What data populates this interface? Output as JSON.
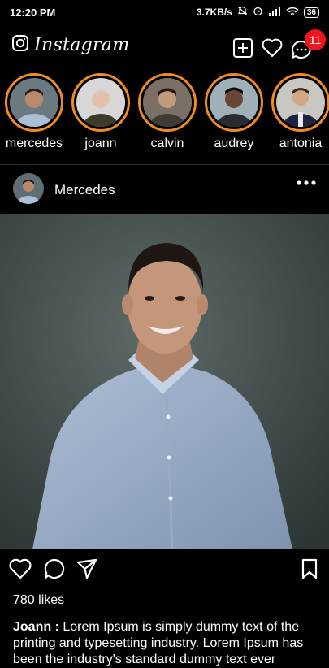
{
  "status_bar": {
    "time": "12:20 PM",
    "speed": "3.7KB/s",
    "battery": "36"
  },
  "header": {
    "logo": "Instagram",
    "notification_count": "11"
  },
  "stories": [
    {
      "name": "mercedes"
    },
    {
      "name": "joann"
    },
    {
      "name": "calvin"
    },
    {
      "name": "audrey"
    },
    {
      "name": "antonia"
    }
  ],
  "post": {
    "username": "Mercedes",
    "likes": "780 likes",
    "caption_user": "Joann :",
    "caption_text": "Lorem Ipsum is simply dummy text of the printing and typesetting industry. Lorem Ipsum has been the industry's standard dummy text ever"
  },
  "icons": {
    "add": "plus-square-icon",
    "activity": "heart-icon",
    "messages": "chat-bubble-icon",
    "like": "heart-icon",
    "comment": "comment-icon",
    "share": "send-icon",
    "save": "bookmark-icon",
    "more": "more-dots-icon"
  },
  "colors": {
    "background": "#000000",
    "story_ring": "#f08a23",
    "badge": "#f0141e"
  }
}
